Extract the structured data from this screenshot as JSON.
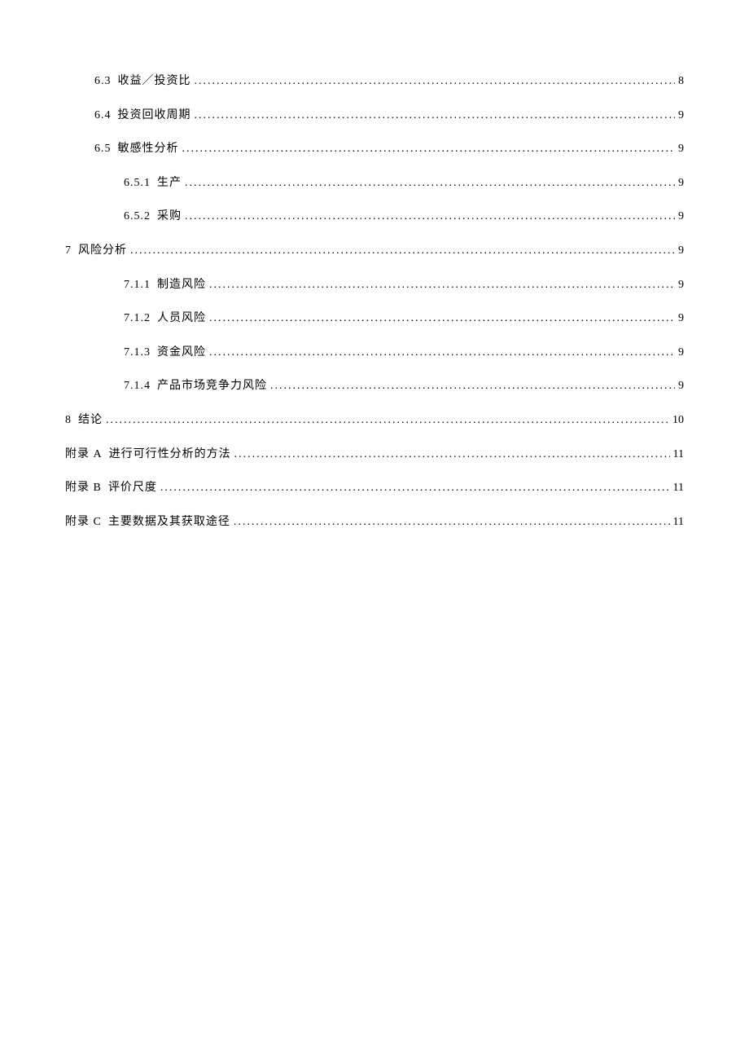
{
  "toc": [
    {
      "indent": 1,
      "prefix": "6.3",
      "title": "收益／投资比",
      "page": "8"
    },
    {
      "indent": 1,
      "prefix": "6.4",
      "title": "投资回收周期",
      "page": "9"
    },
    {
      "indent": 1,
      "prefix": "6.5",
      "title": "敏感性分析",
      "page": "9"
    },
    {
      "indent": 2,
      "prefix": "6.5.1",
      "title": "生产",
      "page": "9"
    },
    {
      "indent": 2,
      "prefix": "6.5.2",
      "title": "采购",
      "page": "9"
    },
    {
      "indent": 0,
      "prefix": "7",
      "title": "风险分析",
      "page": "9"
    },
    {
      "indent": 2,
      "prefix": "7.1.1",
      "title": "制造风险",
      "page": "9"
    },
    {
      "indent": 2,
      "prefix": "7.1.2",
      "title": "人员风险",
      "page": "9"
    },
    {
      "indent": 2,
      "prefix": "7.1.3",
      "title": "资金风险",
      "page": "9"
    },
    {
      "indent": 2,
      "prefix": "7.1.4",
      "title": "产品市场竞争力风险",
      "page": "9"
    },
    {
      "indent": 0,
      "prefix": "8",
      "title": "结论",
      "page": "10"
    },
    {
      "indent": 0,
      "prefix": "附录 A",
      "title": "进行可行性分析的方法",
      "page": "11"
    },
    {
      "indent": 0,
      "prefix": "附录 B",
      "title": "评价尺度",
      "page": "11"
    },
    {
      "indent": 0,
      "prefix": "附录 C",
      "title": "主要数据及其获取途径",
      "page": "11"
    }
  ]
}
